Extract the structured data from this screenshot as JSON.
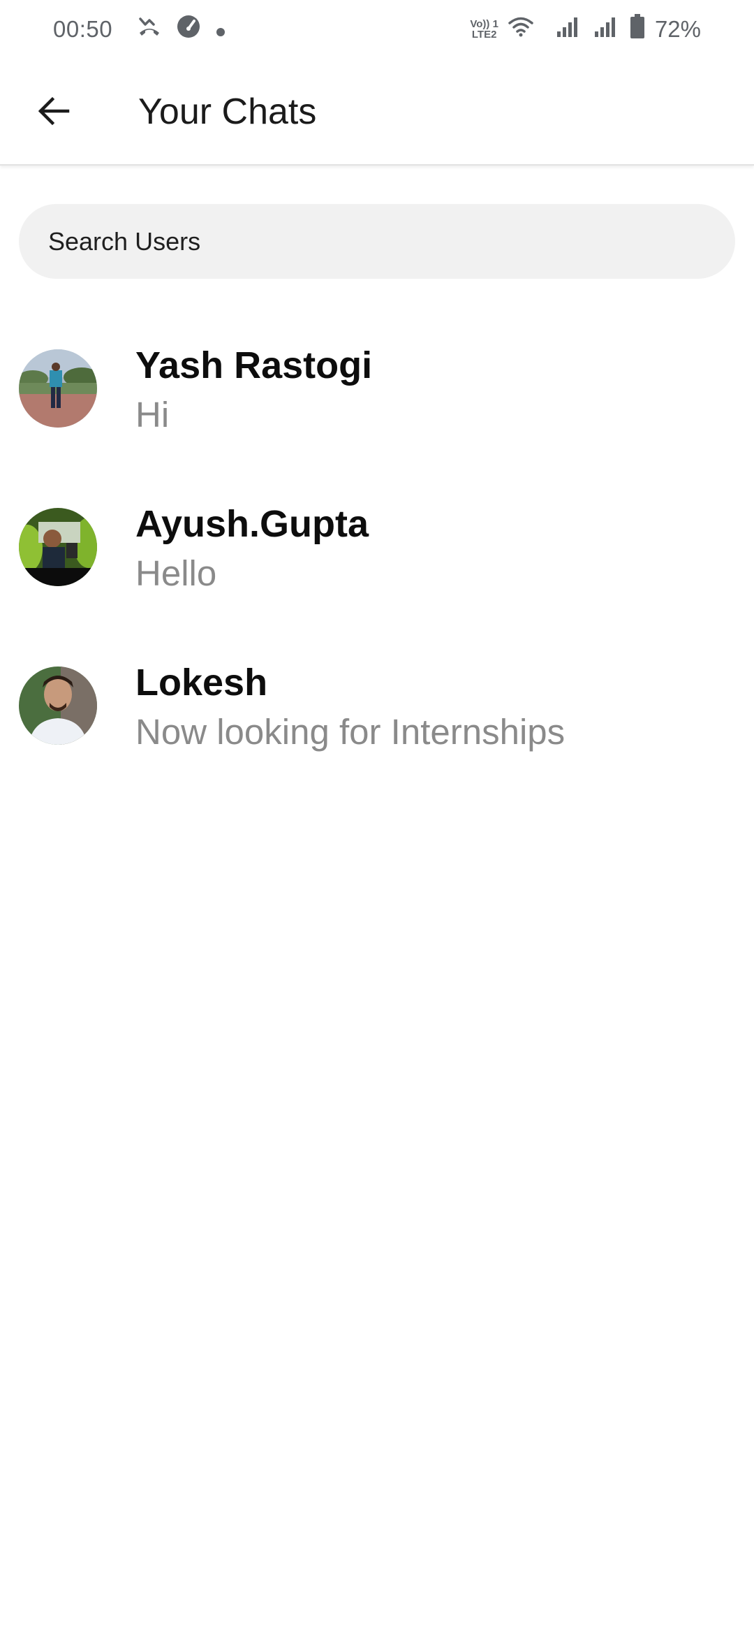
{
  "status_bar": {
    "time": "00:50",
    "battery_percent": "72%",
    "network_label_top": "Vo)) 1",
    "network_label_bottom": "LTE2",
    "icons": [
      "missed-call-icon",
      "speedometer-icon",
      "notification-dot-icon",
      "volte-lte-icon",
      "wifi-icon",
      "signal-icon",
      "signal-icon",
      "battery-icon"
    ]
  },
  "app_bar": {
    "title": "Your Chats",
    "back_icon": "arrow-left-icon"
  },
  "search": {
    "placeholder": "Search Users",
    "value": ""
  },
  "chats": [
    {
      "name": "Yash Rastogi",
      "last_message": "Hi"
    },
    {
      "name": "Ayush.Gupta",
      "last_message": "Hello"
    },
    {
      "name": "Lokesh",
      "last_message": "Now looking for Internships"
    }
  ]
}
